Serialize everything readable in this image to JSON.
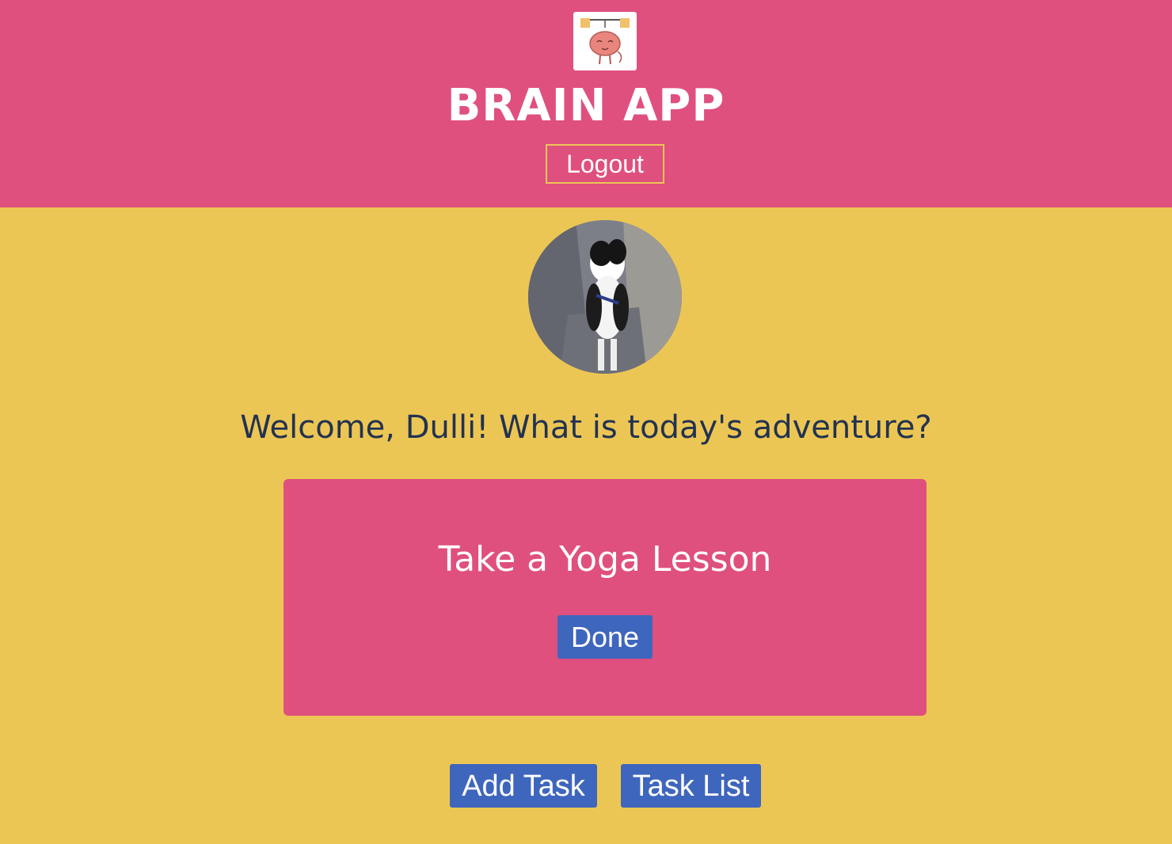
{
  "header": {
    "logo_icon": "brain-lifting-weights-icon",
    "title": "BRAIN APP",
    "logout_label": "Logout"
  },
  "profile": {
    "avatar_icon": "dog-photo-avatar"
  },
  "welcome": {
    "text": "Welcome, Dulli! What is today's adventure?"
  },
  "task_card": {
    "title": "Take a Yoga Lesson",
    "done_label": "Done"
  },
  "actions": {
    "add_task_label": "Add Task",
    "task_list_label": "Task List"
  },
  "colors": {
    "header_bg": "#df507e",
    "page_bg": "#ecc654",
    "card_bg": "#df507e",
    "button_bg": "#3f66bd",
    "welcome_text": "#223251"
  }
}
